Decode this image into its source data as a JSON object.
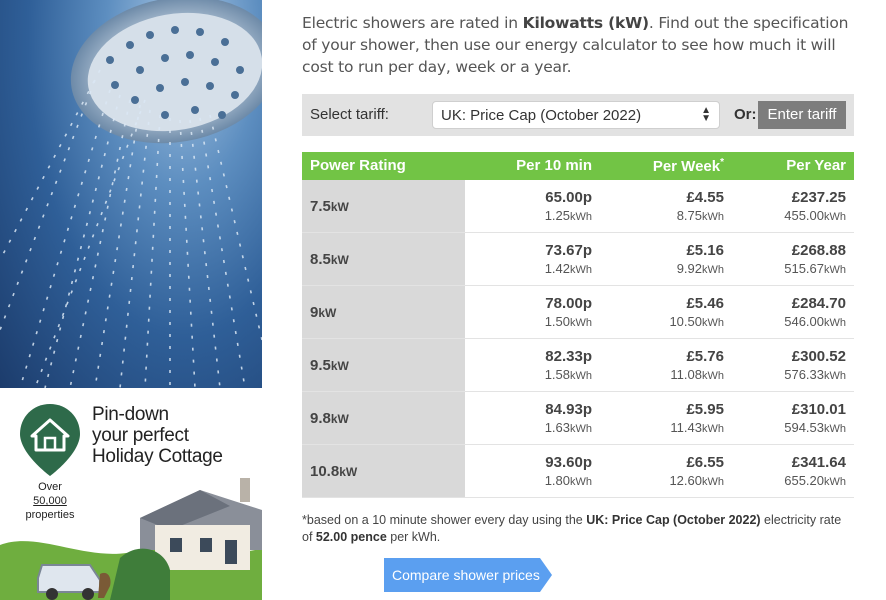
{
  "intro": {
    "part1": "Electric showers are rated in ",
    "bold": "Kilowatts (kW)",
    "part2": ". Find out the specification of your shower, then use our energy calculator to see how much it will cost to run per day, week or a year."
  },
  "tariff": {
    "label": "Select tariff:",
    "selected": "UK: Price Cap (October 2022)",
    "or_label": "Or:",
    "enter_button": "Enter tariff"
  },
  "table": {
    "headers": [
      "Power Rating",
      "Per 10 min",
      "Per Week",
      "Per Year"
    ],
    "week_star": "*",
    "rows": [
      {
        "rating": "7.5",
        "unit": "kW",
        "min_cost": "65.00p",
        "min_kwh": "1.25",
        "week_cost": "£4.55",
        "week_kwh": "8.75",
        "year_cost": "£237.25",
        "year_kwh": "455.00",
        "kwh_unit": "kWh"
      },
      {
        "rating": "8.5",
        "unit": "kW",
        "min_cost": "73.67p",
        "min_kwh": "1.42",
        "week_cost": "£5.16",
        "week_kwh": "9.92",
        "year_cost": "£268.88",
        "year_kwh": "515.67",
        "kwh_unit": "kWh"
      },
      {
        "rating": "9",
        "unit": "kW",
        "min_cost": "78.00p",
        "min_kwh": "1.50",
        "week_cost": "£5.46",
        "week_kwh": "10.50",
        "year_cost": "£284.70",
        "year_kwh": "546.00",
        "kwh_unit": "kWh"
      },
      {
        "rating": "9.5",
        "unit": "kW",
        "min_cost": "82.33p",
        "min_kwh": "1.58",
        "week_cost": "£5.76",
        "week_kwh": "11.08",
        "year_cost": "£300.52",
        "year_kwh": "576.33",
        "kwh_unit": "kWh"
      },
      {
        "rating": "9.8",
        "unit": "kW",
        "min_cost": "84.93p",
        "min_kwh": "1.63",
        "week_cost": "£5.95",
        "week_kwh": "11.43",
        "year_cost": "£310.01",
        "year_kwh": "594.53",
        "kwh_unit": "kWh"
      },
      {
        "rating": "10.8",
        "unit": "kW",
        "min_cost": "93.60p",
        "min_kwh": "1.80",
        "week_cost": "£6.55",
        "week_kwh": "12.60",
        "year_cost": "£341.64",
        "year_kwh": "655.20",
        "kwh_unit": "kWh"
      }
    ]
  },
  "footnote": {
    "part1": "*based on a 10 minute shower every day using the ",
    "tariff": "UK: Price Cap (October 2022)",
    "part2": " electricity rate of ",
    "rate": "52.00 pence",
    "part3": " per kWh."
  },
  "compare_button": "Compare shower prices",
  "ad": {
    "line1": "Pin-down",
    "line2": "your perfect",
    "line3": "Holiday Cottage",
    "over": "Over",
    "count": "50,000",
    "properties": "properties"
  },
  "colors": {
    "header_green": "#72c445",
    "button_blue": "#5b9ff0",
    "pin_green": "#2e6a4a"
  }
}
